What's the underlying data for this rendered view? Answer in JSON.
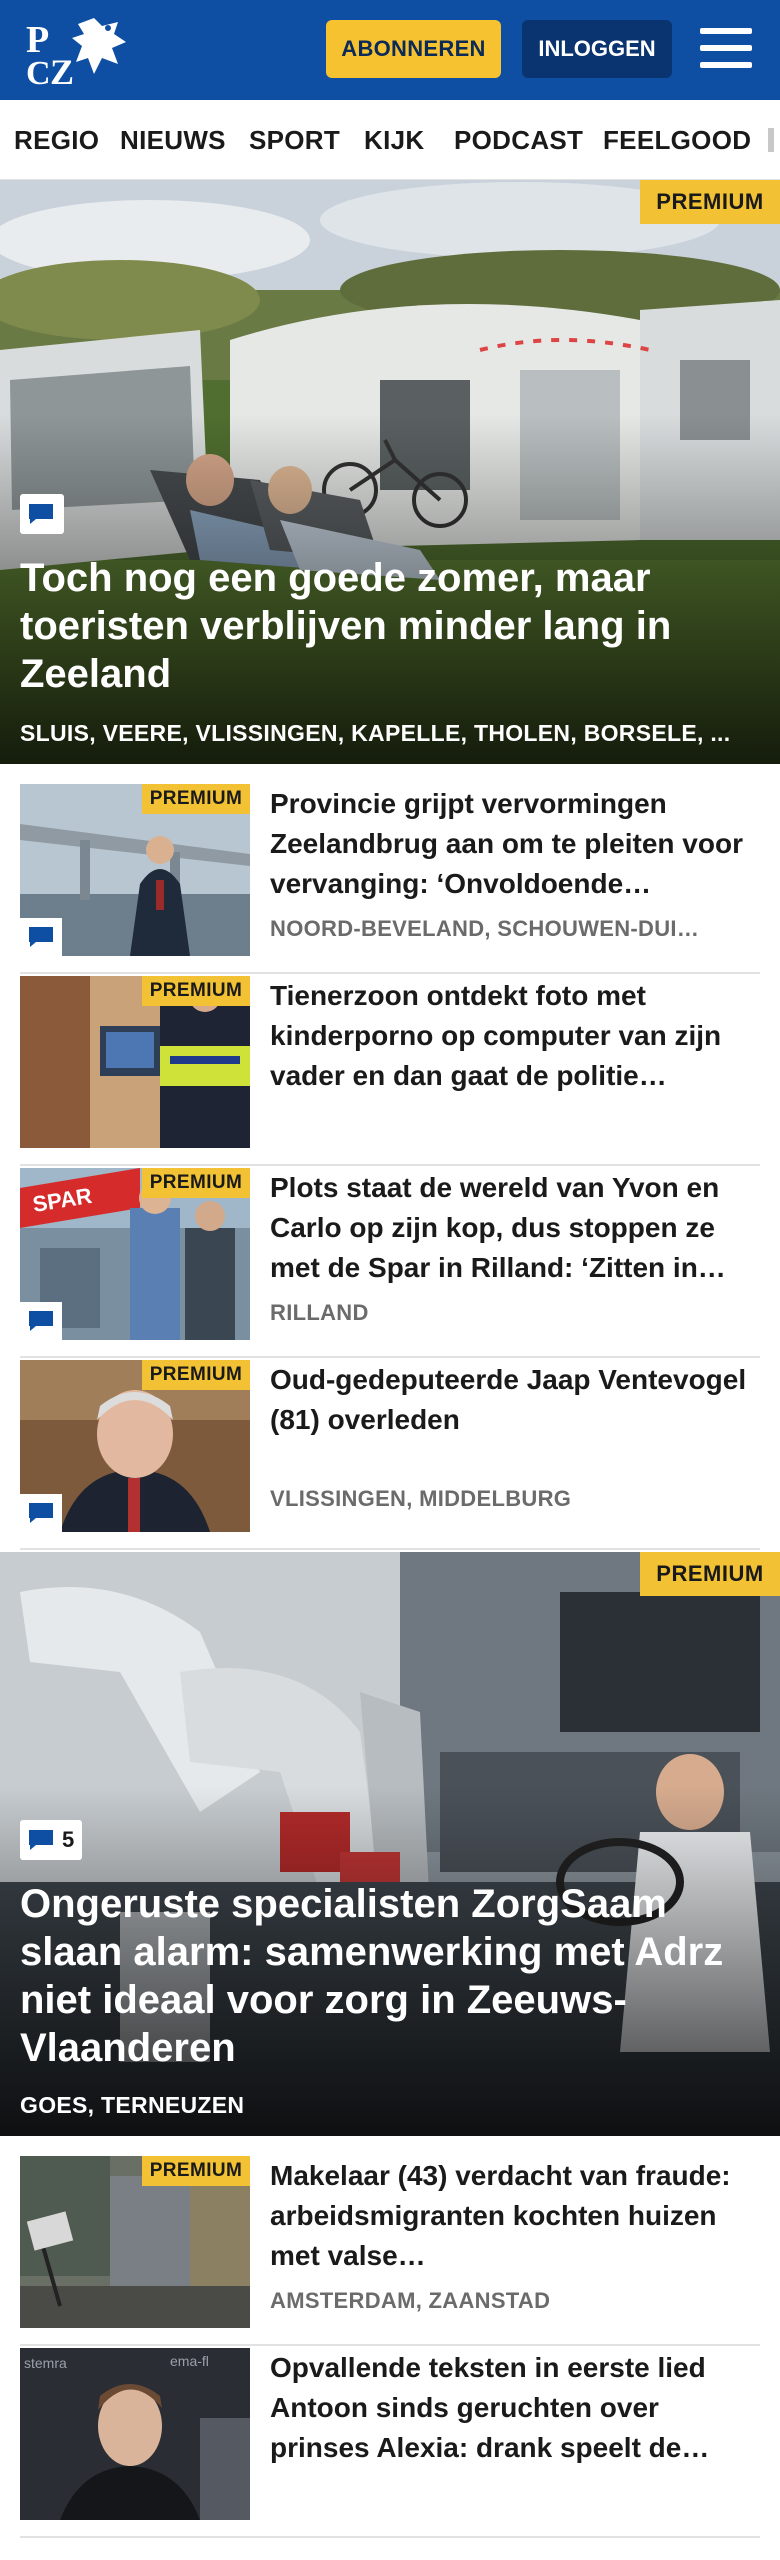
{
  "header": {
    "logo_text": "PZC",
    "subscribe_label": "ABONNEREN",
    "login_label": "INLOGGEN",
    "menu_icon": "hamburger-menu-icon",
    "brand_color": "#0e4fa3",
    "accent_color": "#f6c230"
  },
  "nav": {
    "items": [
      "REGIO",
      "NIEUWS",
      "SPORT",
      "KIJK",
      "PODCAST",
      "FEELGOOD"
    ]
  },
  "hero1": {
    "badge": "PREMIUM",
    "comment_icon": "comment-icon",
    "title": "Toch nog een goede zomer, maar toeristen verblijven minder lang in Zeeland",
    "locations": "SLUIS, VEERE, VLISSINGEN, KAPELLE, THOLEN, BORSELE, ..."
  },
  "articles1": [
    {
      "badge": "PREMIUM",
      "title": "Provincie grijpt vervormingen Zeelandbrug aan om te pleiten voor vervanging: ‘Onvoldoende…",
      "locations": "NOORD-BEVELAND, SCHOUWEN-DUI…"
    },
    {
      "badge": "PREMIUM",
      "title": "Tienerzoon ontdekt foto met kinderporno op computer van zijn vader en dan gaat de politie…",
      "locations": ""
    },
    {
      "badge": "PREMIUM",
      "title": "Plots staat de wereld van Yvon en Carlo op zijn kop, dus stoppen ze met de Spar in Rilland: ‘Zitten in…",
      "locations": "RILLAND"
    },
    {
      "badge": "PREMIUM",
      "title": "Oud-gedeputeerde Jaap Ventevogel (81) overleden",
      "locations": "VLISSINGEN, MIDDELBURG"
    }
  ],
  "hero2": {
    "badge": "PREMIUM",
    "comment_count": "5",
    "title": "Ongeruste specialisten ZorgSaam slaan alarm: samenwerking met Adrz niet ideaal voor zorg in Zeeuws-Vlaanderen",
    "locations": "GOES, TERNEUZEN"
  },
  "articles2": [
    {
      "badge": "PREMIUM",
      "title": "Makelaar (43) verdacht van fraude: arbeidsmigranten kochten huizen met valse…",
      "locations": "AMSTERDAM, ZAANSTAD"
    },
    {
      "badge": "",
      "title": "Opvallende teksten in eerste lied Antoon sinds geruchten over prinses Alexia: drank speelt de…",
      "locations": ""
    }
  ]
}
